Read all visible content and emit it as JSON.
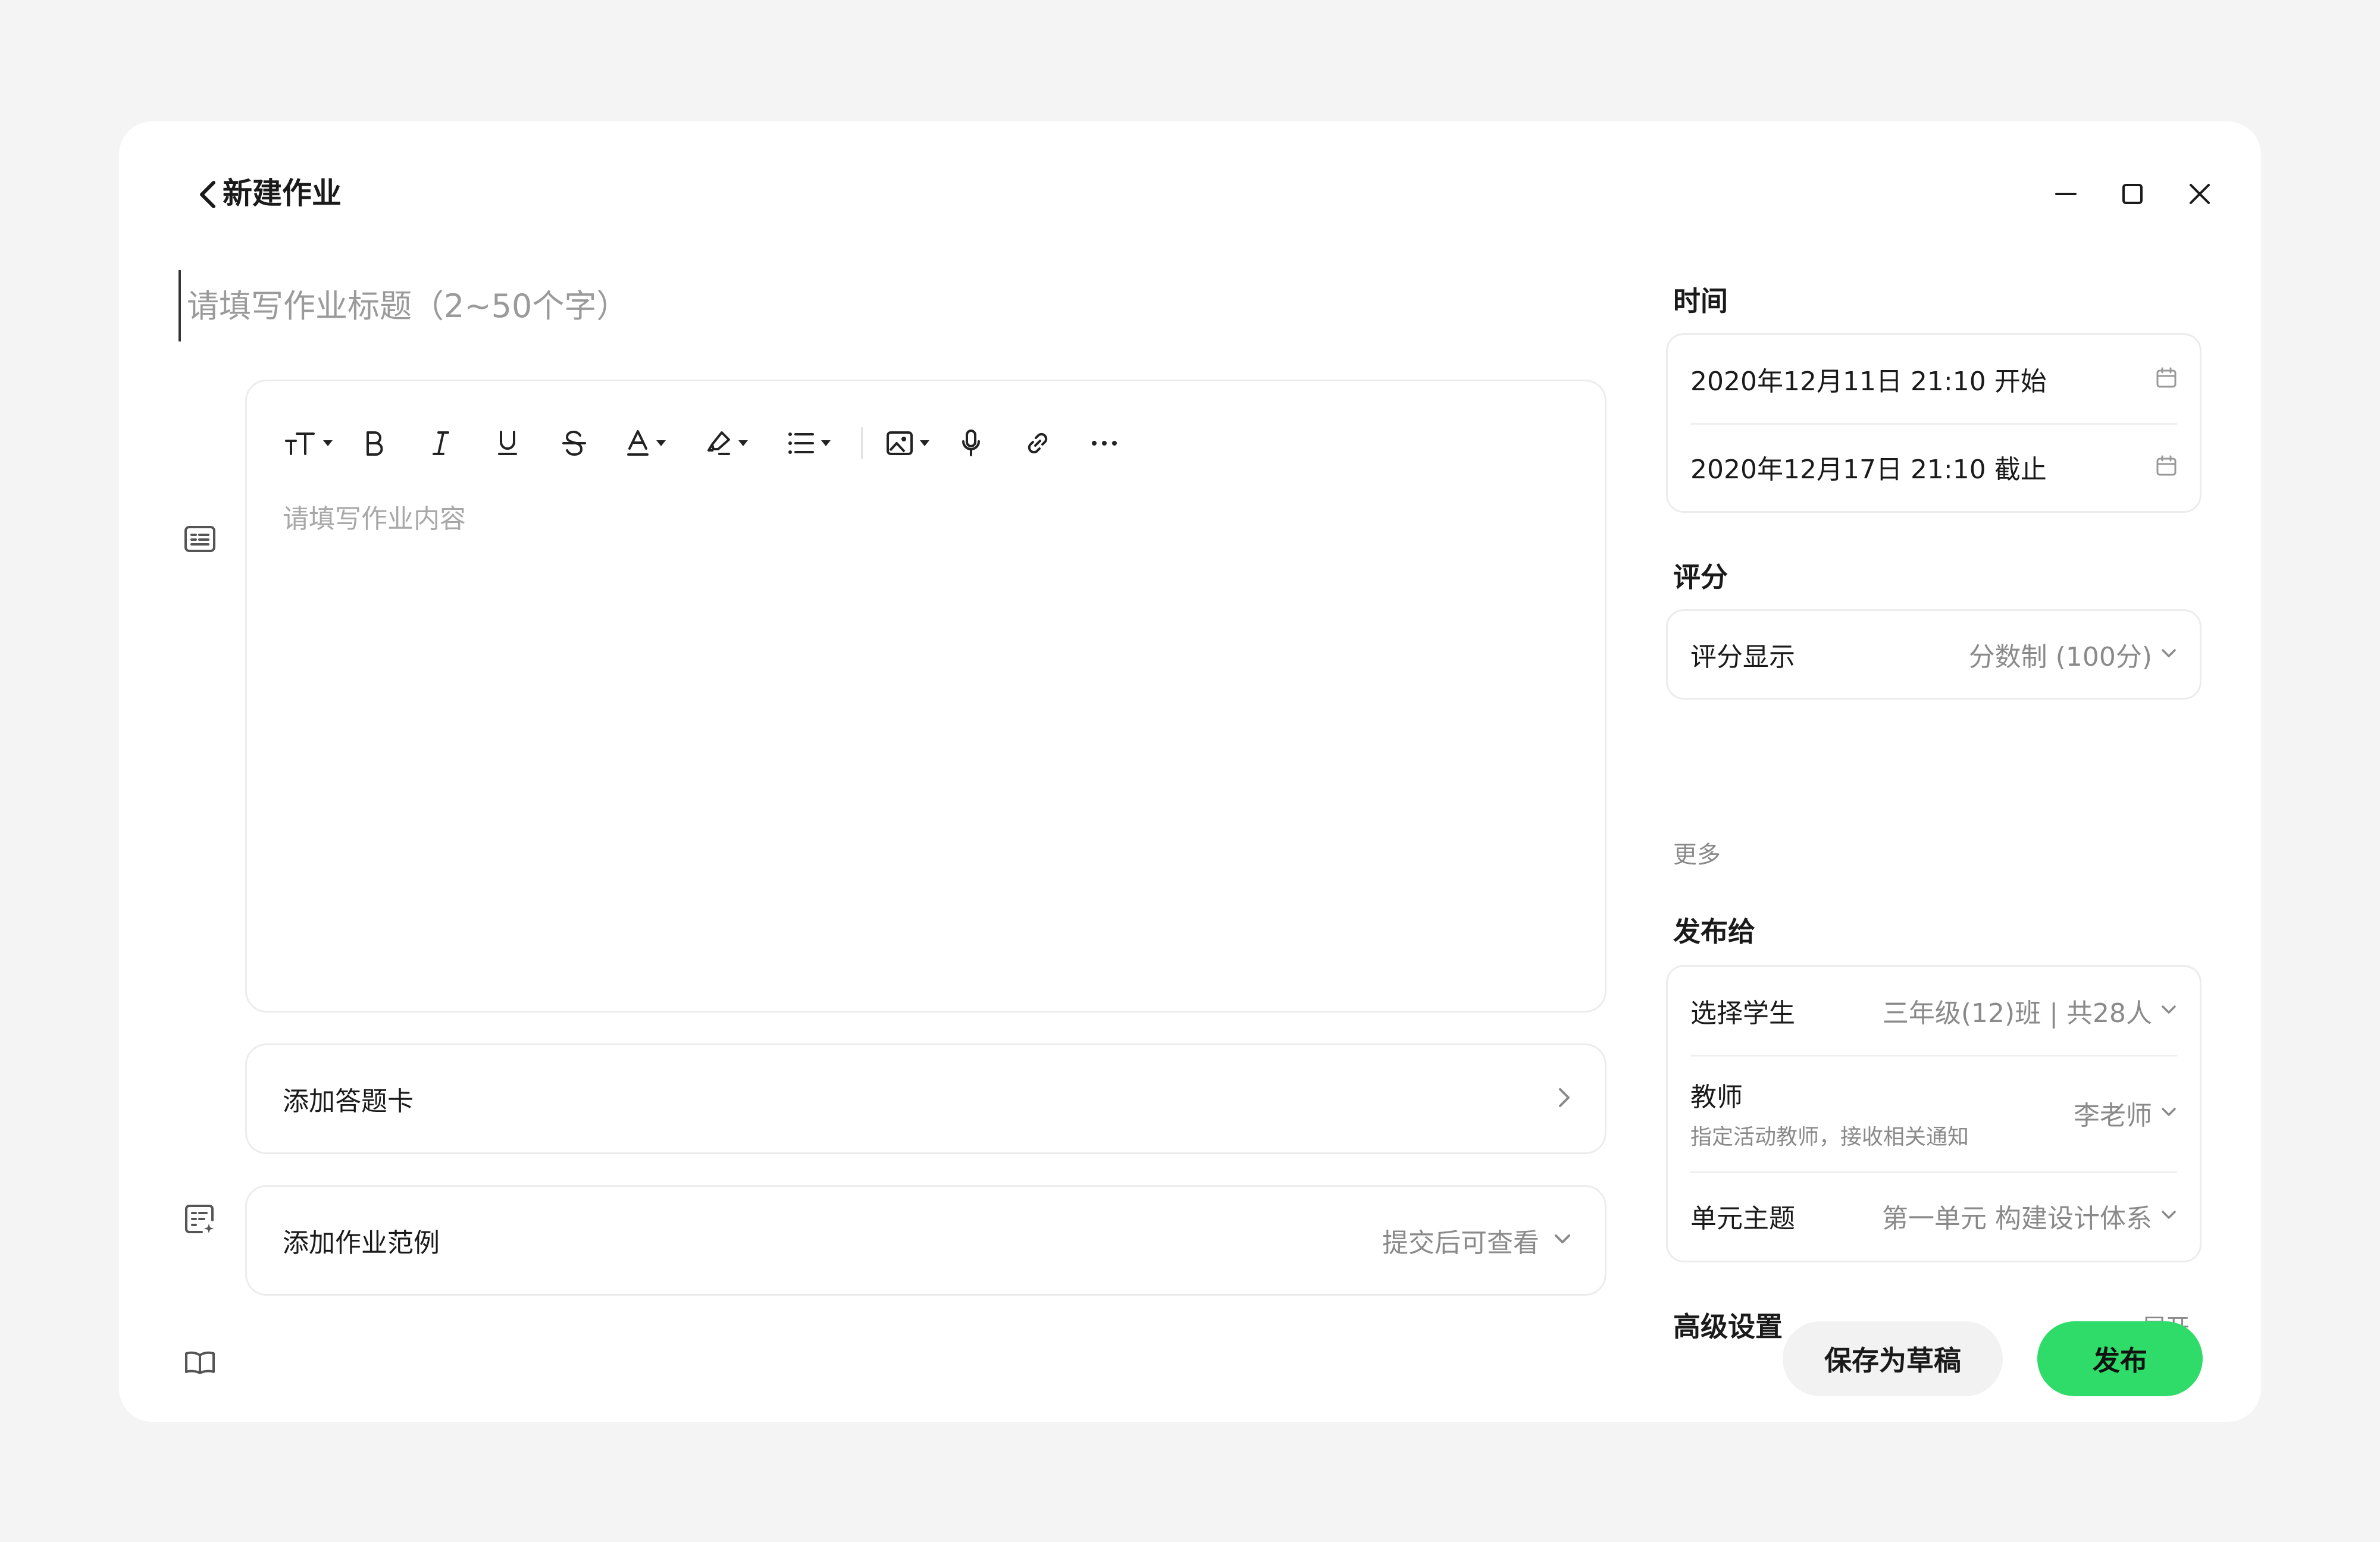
{
  "header": {
    "title": "新建作业"
  },
  "title_input": {
    "placeholder": "请填写作业标题（2~50个字）",
    "value": ""
  },
  "editor": {
    "placeholder": "请填写作业内容",
    "value": ""
  },
  "answer_card": {
    "label": "添加答题卡"
  },
  "example": {
    "label": "添加作业范例",
    "value": "提交后可查看"
  },
  "time": {
    "title": "时间",
    "start": "2020年12月11日 21:10 开始",
    "end": "2020年12月17日 21:10 截止"
  },
  "scoring": {
    "title": "评分",
    "label": "评分显示",
    "value": "分数制 (100分)",
    "more": "更多"
  },
  "publish_to": {
    "title": "发布给",
    "students_label": "选择学生",
    "students_value": "三年级(12)班 | 共28人",
    "teacher_label": "教师",
    "teacher_sub": "指定活动教师，接收相关通知",
    "teacher_value": "李老师",
    "unit_label": "单元主题",
    "unit_value": "第一单元 构建设计体系"
  },
  "advanced": {
    "title": "高级设置",
    "expand": "展开"
  },
  "actions": {
    "draft": "保存为草稿",
    "publish": "发布"
  },
  "colors": {
    "accent": "#2fdc6a",
    "border": "#ececec",
    "muted": "#8a8a8a"
  }
}
